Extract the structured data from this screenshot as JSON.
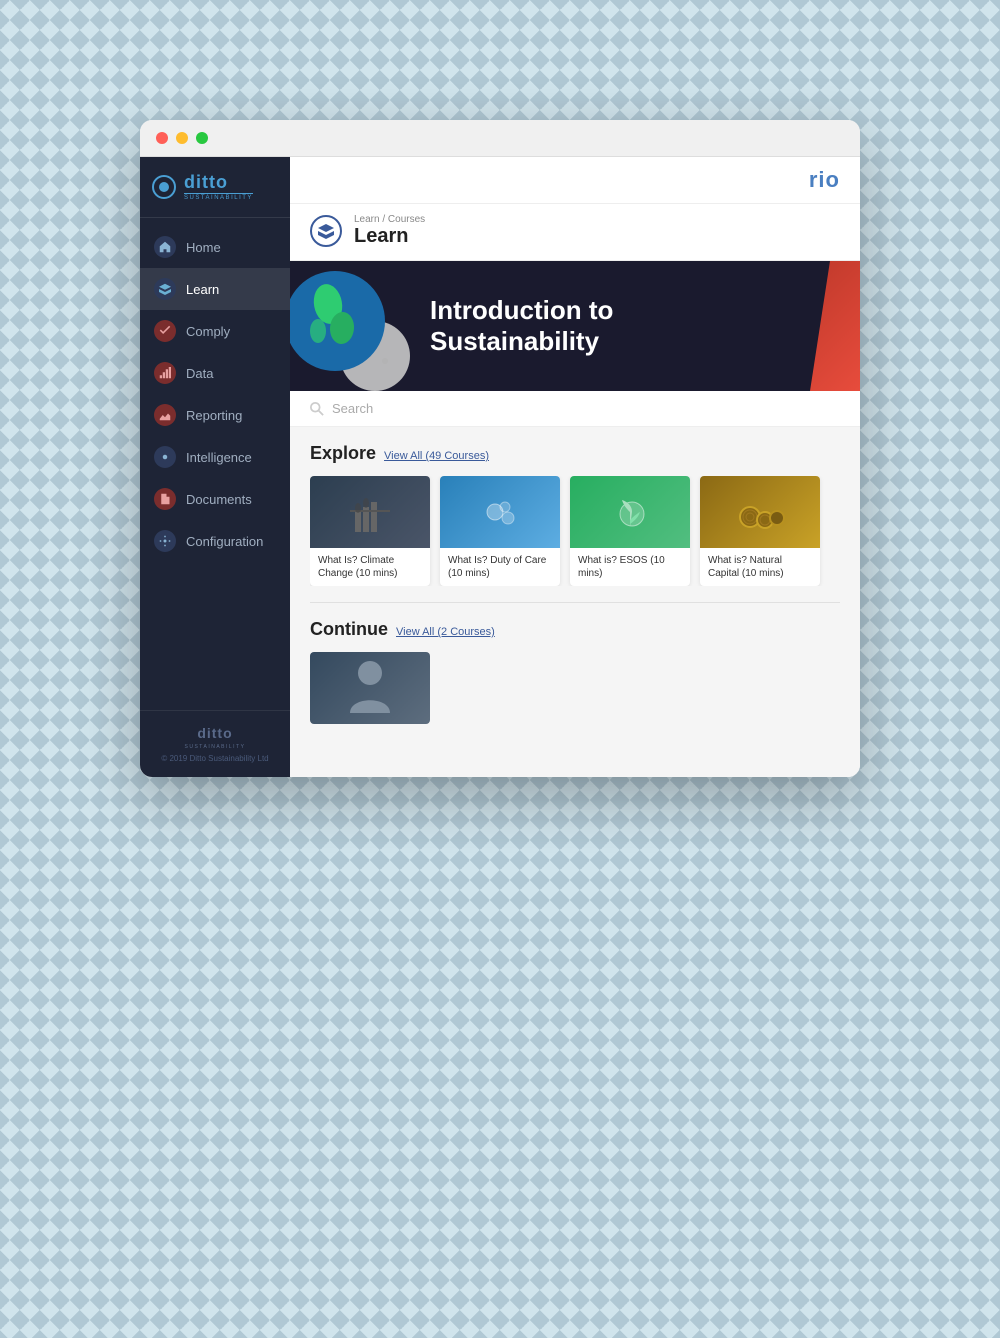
{
  "browser": {
    "traffic_lights": [
      "red",
      "yellow",
      "green"
    ]
  },
  "header": {
    "logo_main": "ditto",
    "logo_sub": "SUSTAINABILITY",
    "logo_right": "rio"
  },
  "breadcrumb": {
    "items": [
      "Learn",
      "Courses"
    ],
    "separator": "/"
  },
  "page": {
    "title": "Learn",
    "icon": "graduation-cap"
  },
  "hero": {
    "title_line1": "Introduction to",
    "title_line2": "Sustainability"
  },
  "search": {
    "placeholder": "Search"
  },
  "explore": {
    "section_title": "Explore",
    "view_all_label": "View All (49 Courses)",
    "courses": [
      {
        "id": 1,
        "name": "What Is? Climate Change (10 mins)",
        "thumb_type": "industrial"
      },
      {
        "id": 2,
        "name": "What Is? Duty of Care (10 mins)",
        "thumb_type": "plastic"
      },
      {
        "id": 3,
        "name": "What is? ESOS (10 mins)",
        "thumb_type": "plant"
      },
      {
        "id": 4,
        "name": "What is? Natural Capital (10 mins)",
        "thumb_type": "wood"
      }
    ]
  },
  "continue": {
    "section_title": "Continue",
    "view_all_label": "View All (2 Courses)"
  },
  "sidebar": {
    "items": [
      {
        "id": "home",
        "label": "Home",
        "icon": "🏠",
        "active": false
      },
      {
        "id": "learn",
        "label": "Learn",
        "icon": "🎓",
        "active": true
      },
      {
        "id": "comply",
        "label": "Comply",
        "icon": "✏️",
        "active": false
      },
      {
        "id": "data",
        "label": "Data",
        "icon": "📊",
        "active": false
      },
      {
        "id": "reporting",
        "label": "Reporting",
        "icon": "📈",
        "active": false
      },
      {
        "id": "intelligence",
        "label": "Intelligence",
        "icon": "⚙️",
        "active": false
      },
      {
        "id": "documents",
        "label": "Documents",
        "icon": "📄",
        "active": false
      },
      {
        "id": "configuration",
        "label": "Configuration",
        "icon": "⚙️",
        "active": false
      }
    ]
  },
  "footer": {
    "logo": "ditto",
    "sub": "SUSTAINABILITY",
    "copyright": "© 2019 Ditto Sustainability Ltd"
  }
}
